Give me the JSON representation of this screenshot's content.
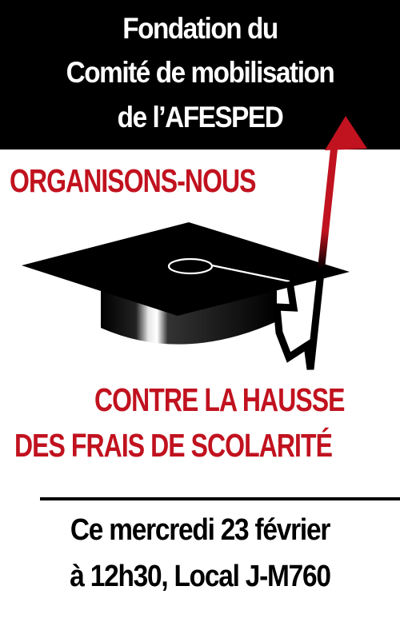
{
  "header": {
    "line1": "Fondation du",
    "line2": "Comité de mobilisation",
    "line3": "de l’AFESPED"
  },
  "slogan": {
    "top": "ORGANISONS-NOUS",
    "bottom_line1": "CONTRE LA HAUSSE",
    "bottom_line2": "DES FRAIS DE SCOLARITÉ"
  },
  "event": {
    "line1": "Ce mercredi 23 février",
    "line2": "à 12h30, Local J-M760"
  },
  "colors": {
    "accent_red": "#c1121f",
    "black": "#000000",
    "white": "#ffffff"
  },
  "icons": {
    "cap": "graduation-cap-icon",
    "arrow": "rising-arrow-icon"
  }
}
